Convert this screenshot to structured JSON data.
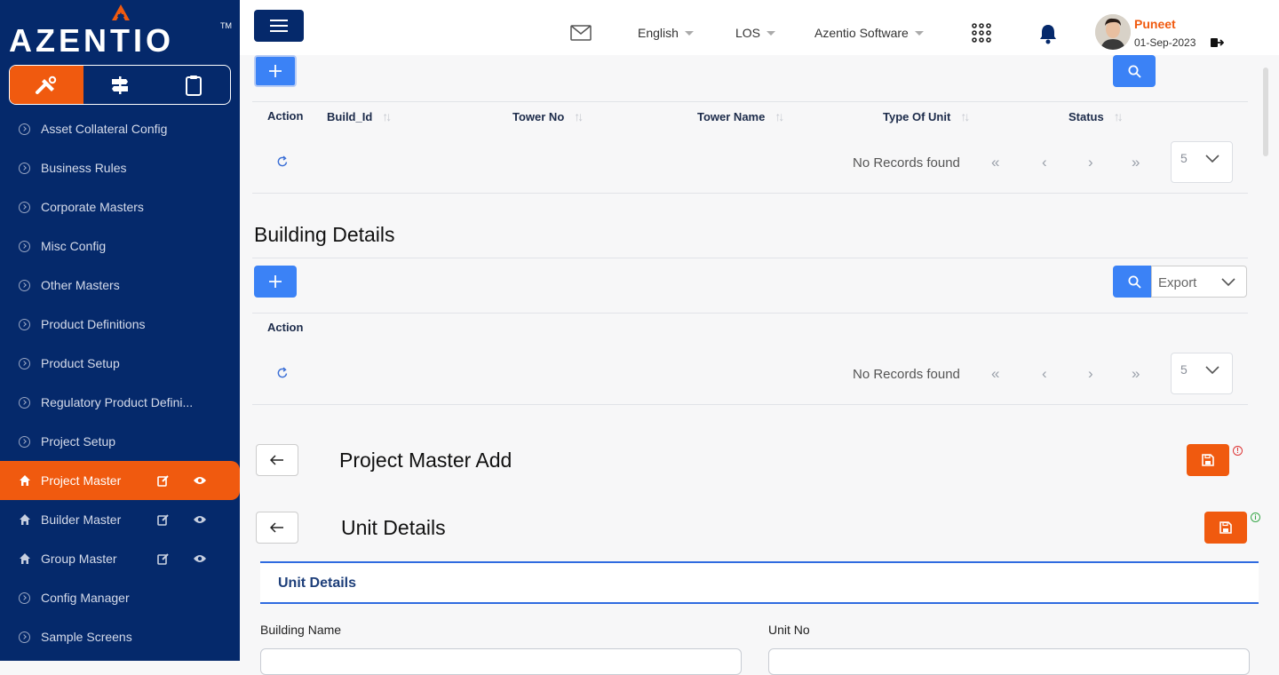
{
  "brand": {
    "name": "AZENTIO",
    "tm": "TM",
    "accent": "#f05a0f",
    "navy": "#05296b"
  },
  "sidebar": {
    "mode_tabs": [
      {
        "icon": "tools-icon",
        "active": true
      },
      {
        "icon": "signpost-icon",
        "active": false
      },
      {
        "icon": "clipboard-icon",
        "active": false
      }
    ],
    "items": [
      {
        "label": "Asset Collateral Config"
      },
      {
        "label": "Business Rules"
      },
      {
        "label": "Corporate Masters"
      },
      {
        "label": "Misc Config"
      },
      {
        "label": "Other Masters"
      },
      {
        "label": "Product Definitions"
      },
      {
        "label": "Product Setup"
      },
      {
        "label": "Regulatory Product Defini..."
      },
      {
        "label": "Project Setup"
      },
      {
        "label": "Project Master"
      },
      {
        "label": "Builder Master"
      },
      {
        "label": "Group Master"
      },
      {
        "label": "Config Manager"
      },
      {
        "label": "Sample Screens"
      }
    ]
  },
  "topbar": {
    "language": "English",
    "module": "LOS",
    "company": "Azentio Software",
    "user_name": "Puneet",
    "date": "01-Sep-2023"
  },
  "tower_table": {
    "columns": [
      "Action",
      "Build_Id",
      "Tower No",
      "Tower Name",
      "Type Of Unit",
      "Status"
    ],
    "empty_text": "No Records found",
    "page_size": "5"
  },
  "building_details": {
    "title": "Building Details",
    "columns": [
      "Action"
    ],
    "empty_text": "No Records found",
    "page_size": "5",
    "export_label": "Export"
  },
  "project_master": {
    "title": "Project Master Add"
  },
  "unit_details": {
    "title": "Unit Details",
    "tab_label": "Unit Details",
    "fields": [
      {
        "label": "Building Name",
        "value": ""
      },
      {
        "label": "Unit No",
        "value": ""
      }
    ]
  }
}
